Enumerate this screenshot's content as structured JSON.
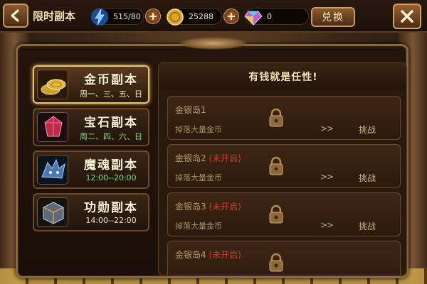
{
  "header": {
    "title": "限时副本",
    "energy": "515/80",
    "gold": "25288",
    "gems": "0",
    "exchange_label": "兑换"
  },
  "tabs": [
    {
      "name": "金币副本",
      "schedule": "周一、三、五、日",
      "icon": "gold-coins-icon",
      "active": true
    },
    {
      "name": "宝石副本",
      "schedule": "周二、四、六、日",
      "icon": "gem-icon",
      "active": false
    },
    {
      "name": "魔魂副本",
      "schedule": "12:00--20:00",
      "icon": "dragon-icon",
      "active": false
    },
    {
      "name": "功勋副本",
      "schedule": "14:00--22:00",
      "icon": "armor-cube-icon",
      "active": false
    }
  ],
  "panel": {
    "heading": "有钱就是任性!",
    "stages": [
      {
        "name": "金银岛1",
        "state": "",
        "desc": "掉落大量金币",
        "arrow": ">>",
        "action": "挑战"
      },
      {
        "name": "金银岛2",
        "state": "(未开启)",
        "desc": "掉落大量金币",
        "arrow": ">>",
        "action": "挑战"
      },
      {
        "name": "金银岛3",
        "state": "(未开启)",
        "desc": "掉落大量金币",
        "arrow": ">>",
        "action": "挑战"
      },
      {
        "name": "金银岛4",
        "state": "(未开启)",
        "desc": "",
        "arrow": "",
        "action": ""
      }
    ]
  },
  "colors": {
    "gold_accent": "#e8c27a",
    "locked_red": "#d03c2c",
    "schedule_green": "#7ee070"
  }
}
